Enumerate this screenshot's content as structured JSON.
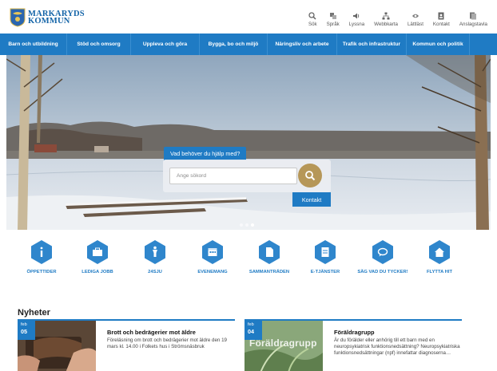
{
  "brand": {
    "line1": "MARKARYDS",
    "line2": "KOMMUN"
  },
  "tools": [
    {
      "label": "Sök",
      "icon": "search-icon"
    },
    {
      "label": "Språk",
      "icon": "language-icon"
    },
    {
      "label": "Lyssna",
      "icon": "speaker-icon"
    },
    {
      "label": "Webbkarta",
      "icon": "sitemap-icon"
    },
    {
      "label": "Lättläst",
      "icon": "easy-read-icon"
    },
    {
      "label": "Kontakt",
      "icon": "contact-icon"
    },
    {
      "label": "Anslagstavla",
      "icon": "notice-board-icon"
    }
  ],
  "nav": [
    "Barn och utbildning",
    "Stöd och omsorg",
    "Uppleva och göra",
    "Bygga, bo och miljö",
    "Näringsliv och arbete",
    "Trafik och infrastruktur",
    "Kommun och politik"
  ],
  "hero": {
    "search_heading": "Vad behöver du hjälp med?",
    "search_placeholder": "Ange sökord",
    "contact_label": "Kontakt",
    "slides": 3,
    "active_slide": 3
  },
  "quick_links": [
    {
      "label": "ÖPPETTIDER",
      "icon": "info-icon"
    },
    {
      "label": "LEDIGA JOBB",
      "icon": "briefcase-icon"
    },
    {
      "label": "24SJU",
      "icon": "person-icon"
    },
    {
      "label": "EVENEMANG",
      "icon": "calendar-icon"
    },
    {
      "label": "SAMMANTRÄDEN",
      "icon": "document-icon"
    },
    {
      "label": "E-TJÄNSTER",
      "icon": "form-icon"
    },
    {
      "label": "SÄG VAD DU TYCKER!",
      "icon": "chat-icon"
    },
    {
      "label": "FLYTTA HIT",
      "icon": "home-icon"
    }
  ],
  "news": {
    "heading": "Nyheter",
    "items": [
      {
        "month": "feb",
        "day": "05",
        "title": "Brott och bedrägerier mot äldre",
        "desc": "Föreläsning om brott och bedrägerier mot äldre den 19 mars kl. 14.00 i Folkets hus i Strömsnäsbruk"
      },
      {
        "month": "feb",
        "day": "04",
        "title": "Föräldragrupp",
        "image_text": "Föräldragrupp",
        "desc": "Är du förälder eller anhörig till ett barn med en neuropsykiatrisk funktionsnedsättning? Neuropsykiatriska funktionsnedsättningar (npf) innefattar diagnoserna…"
      }
    ]
  },
  "colors": {
    "primary": "#1f7bc4",
    "accent_gold": "#b69758",
    "brand_blue": "#1565a8"
  }
}
